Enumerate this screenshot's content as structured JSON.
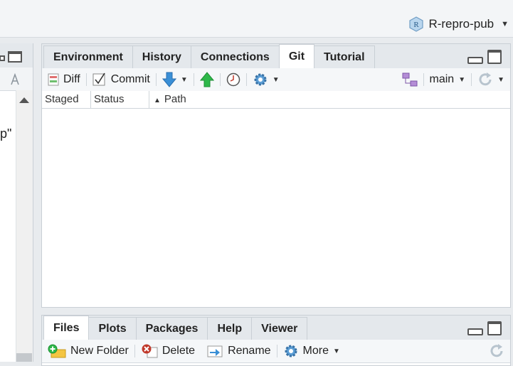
{
  "project": {
    "name": "R-repro-pub",
    "icon": "r-project-icon"
  },
  "left_pane": {
    "fragment_text": "p\""
  },
  "git_pane": {
    "tabs": [
      {
        "label": "Environment",
        "active": false
      },
      {
        "label": "History",
        "active": false
      },
      {
        "label": "Connections",
        "active": false
      },
      {
        "label": "Git",
        "active": true
      },
      {
        "label": "Tutorial",
        "active": false
      }
    ],
    "toolbar": {
      "diff_label": "Diff",
      "commit_label": "Commit",
      "branch_label": "main"
    },
    "columns": {
      "staged": "Staged",
      "status": "Status",
      "path": "Path"
    },
    "sort_indicator": "▲"
  },
  "files_pane": {
    "tabs": [
      {
        "label": "Files",
        "active": true
      },
      {
        "label": "Plots",
        "active": false
      },
      {
        "label": "Packages",
        "active": false
      },
      {
        "label": "Help",
        "active": false
      },
      {
        "label": "Viewer",
        "active": false
      }
    ],
    "toolbar": {
      "new_folder_label": "New Folder",
      "delete_label": "Delete",
      "rename_label": "Rename",
      "more_label": "More"
    }
  },
  "colors": {
    "accent_blue": "#3a8fd6",
    "push_green": "#2eb84a",
    "delete_red": "#c0392b"
  }
}
